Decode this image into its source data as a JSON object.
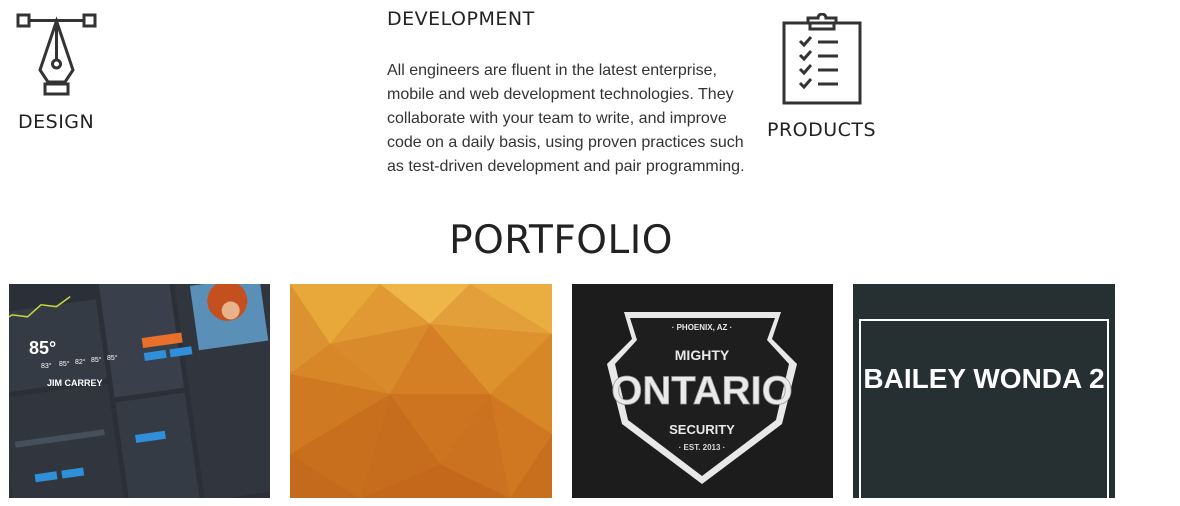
{
  "services": {
    "design": {
      "label": "DESIGN",
      "icon": "pen-nib-icon"
    },
    "development": {
      "title": "DEVELOPMENT",
      "body": "All engineers are fluent in the latest enterprise, mobile and web development technologies. They collaborate with your team to write, and improve code on a daily basis, using proven practices such as test-driven development and pair programming."
    },
    "products": {
      "label": "PRODUCTS",
      "icon": "clipboard-checklist-icon"
    }
  },
  "portfolio": {
    "title": "PORTFOLIO",
    "items": [
      {
        "kind": "ui-kit-preview",
        "texts": {
          "temp": "85°",
          "name": "JIM CARREY",
          "temps": [
            "83°",
            "85°",
            "82°",
            "85°",
            "85°"
          ]
        }
      },
      {
        "kind": "orange-low-poly-background"
      },
      {
        "kind": "security-badge-logo",
        "texts": {
          "top": "· PHOENIX, AZ ·",
          "line1": "MIGHTY",
          "line2": "ONTARIO",
          "line3": "SECURITY",
          "bottom": "· EST. 2013 ·"
        }
      },
      {
        "kind": "title-card",
        "title": "BAILEY WONDA 2"
      }
    ]
  },
  "colors": {
    "text": "#222222",
    "tile4_bg": "#263033",
    "orange": "#d88a2a"
  }
}
